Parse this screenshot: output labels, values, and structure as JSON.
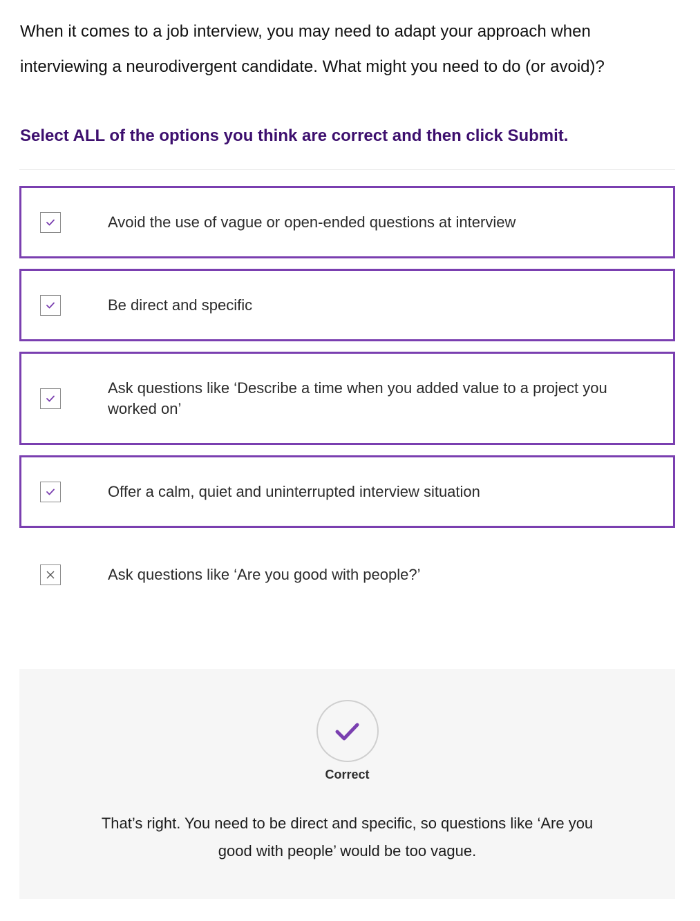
{
  "question": {
    "text": "When it comes to a job interview, you may need to adapt your approach when interviewing a neurodivergent candidate. What might you need to do (or avoid)?"
  },
  "instruction": "Select ALL of the options you think are correct and then click Submit.",
  "options": [
    {
      "label": "Avoid the use of vague or open-ended questions at interview",
      "state": "checked"
    },
    {
      "label": "Be direct and specific",
      "state": "checked"
    },
    {
      "label": "Ask questions like ‘Describe a time when you added value to a project you worked on’",
      "state": "checked"
    },
    {
      "label": "Offer a calm, quiet and uninterrupted interview situation",
      "state": "checked"
    },
    {
      "label": "Ask questions like ‘Are you good with people?’",
      "state": "crossed"
    }
  ],
  "feedback": {
    "icon": "checkmark-icon",
    "result_label": "Correct",
    "message": "That’s right. You need to be direct and specific, so questions like ‘Are you good with people’ would be too vague."
  },
  "colors": {
    "accent": "#7a3fb0",
    "instruction": "#3d0f6e",
    "feedback_bg": "#f6f6f6"
  }
}
